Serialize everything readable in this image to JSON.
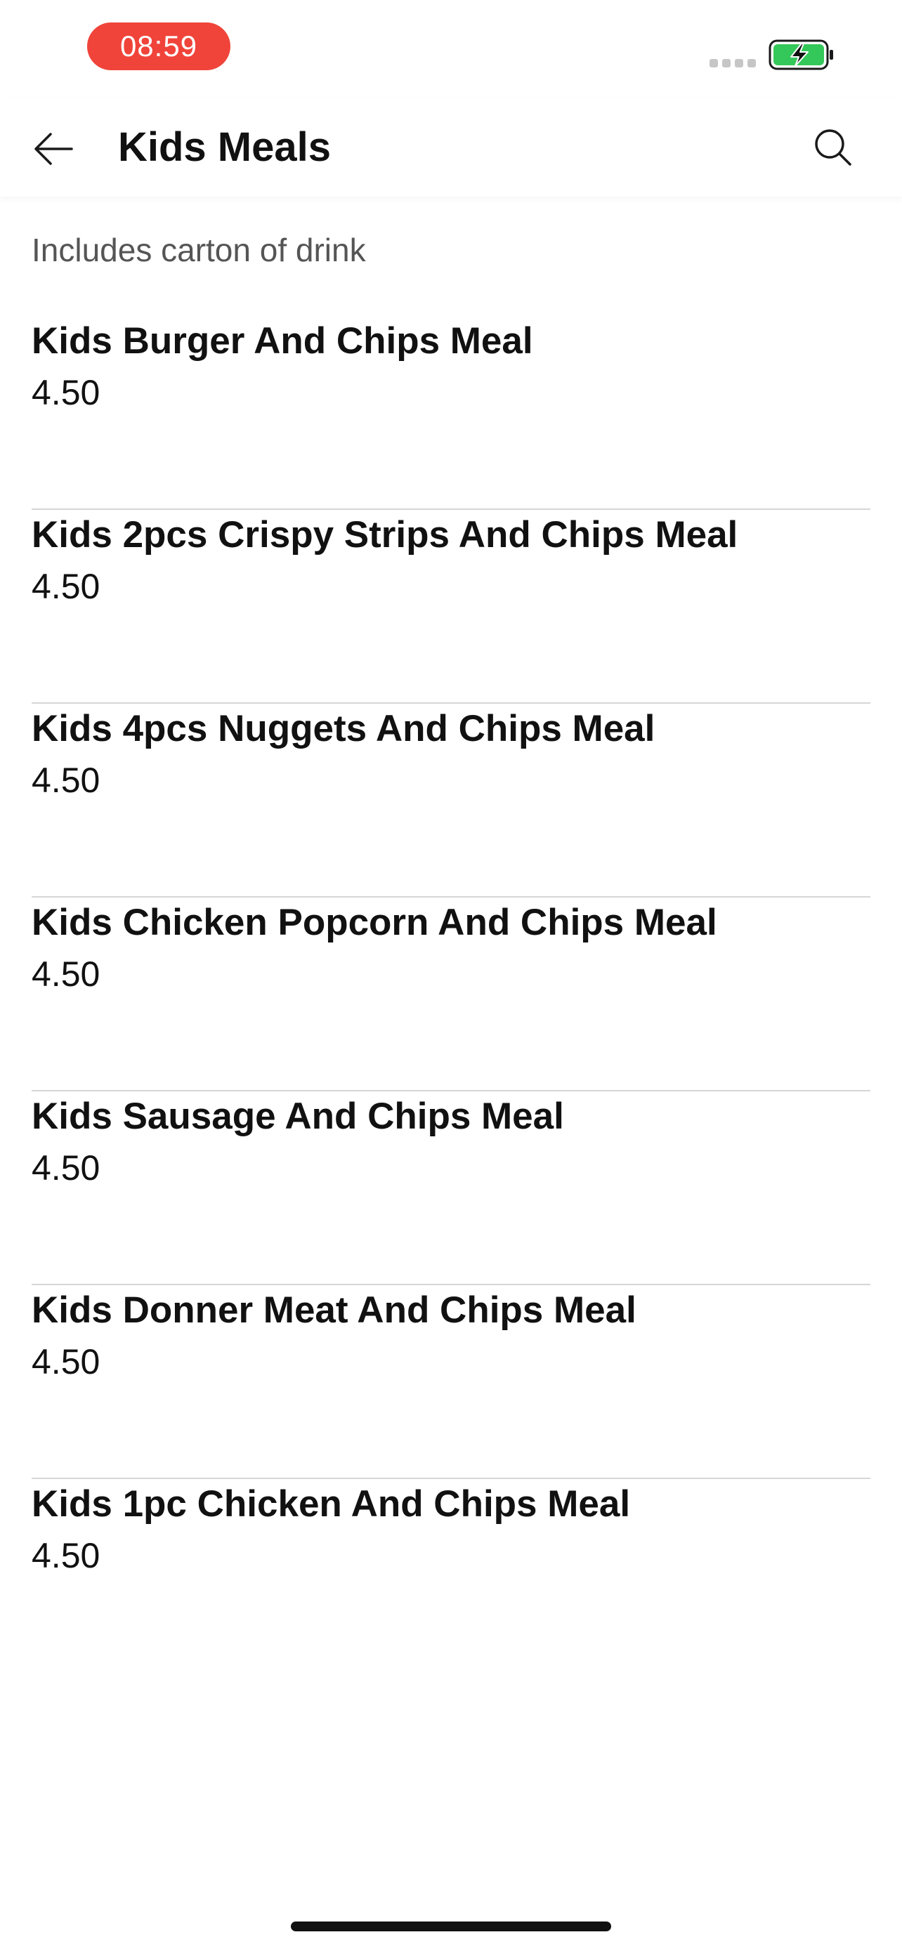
{
  "status_bar": {
    "time": "08:59",
    "battery_icon": "battery-charging-icon",
    "signal_icon": "signal-dots-icon",
    "time_pill_color": "#f0443a",
    "battery_color": "#34c759"
  },
  "header": {
    "title": "Kids Meals",
    "back_icon": "arrow-left-icon",
    "search_icon": "search-icon"
  },
  "category": {
    "description": "Includes carton of drink"
  },
  "items": [
    {
      "name": "Kids Burger And Chips Meal",
      "price": "4.50"
    },
    {
      "name": "Kids 2pcs Crispy Strips And Chips Meal",
      "price": "4.50"
    },
    {
      "name": "Kids 4pcs Nuggets And Chips Meal",
      "price": "4.50"
    },
    {
      "name": "Kids Chicken Popcorn And Chips Meal",
      "price": "4.50"
    },
    {
      "name": "Kids Sausage And Chips Meal",
      "price": "4.50"
    },
    {
      "name": "Kids Donner Meat And Chips Meal",
      "price": "4.50"
    },
    {
      "name": "Kids 1pc Chicken And Chips Meal",
      "price": "4.50"
    }
  ]
}
